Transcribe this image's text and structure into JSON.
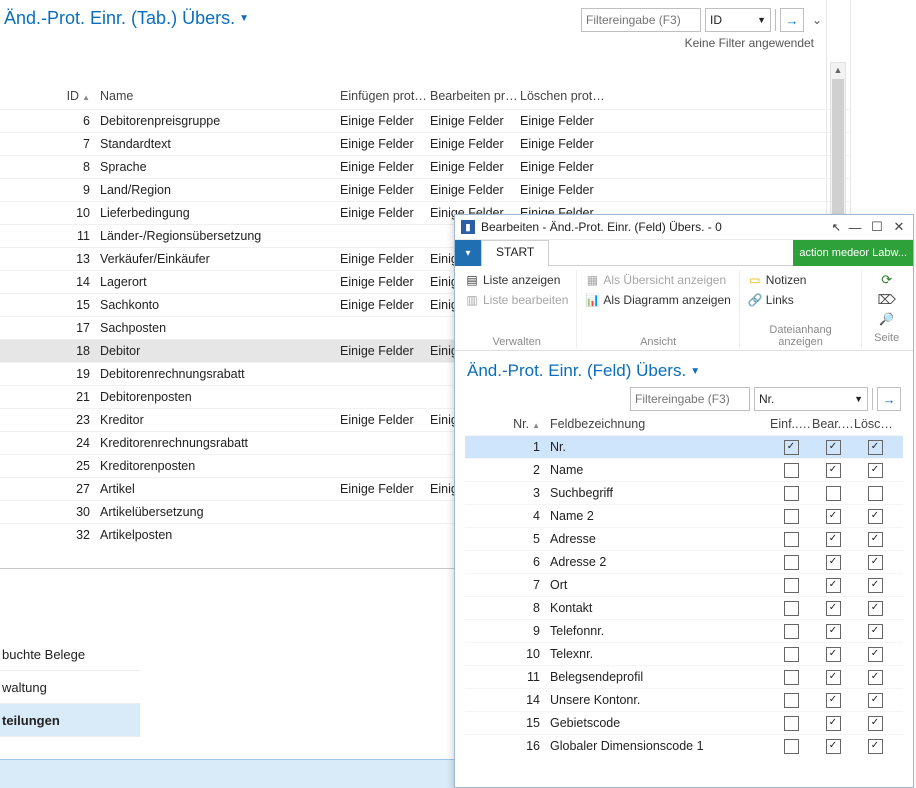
{
  "main": {
    "title": "Änd.-Prot. Einr. (Tab.) Übers.",
    "filter": {
      "placeholder": "Filtereingabe (F3)",
      "field": "ID",
      "go": "→"
    },
    "no_filter": "Keine Filter angewendet",
    "columns": {
      "id": "ID",
      "name": "Name",
      "ins": "Einfügen protokollier...",
      "upd": "Bearbeiten protokollier...",
      "del": "Löschen protokollier..."
    },
    "cell_default": "Einige Felder",
    "cell_trunc": "Einige...",
    "rows": [
      {
        "id": 6,
        "name": "Debitorenpreisgruppe",
        "ins": true,
        "upd": true,
        "del": true
      },
      {
        "id": 7,
        "name": "Standardtext",
        "ins": true,
        "upd": true,
        "del": true
      },
      {
        "id": 8,
        "name": "Sprache",
        "ins": true,
        "upd": true,
        "del": true
      },
      {
        "id": 9,
        "name": "Land/Region",
        "ins": true,
        "upd": true,
        "del": true
      },
      {
        "id": 10,
        "name": "Lieferbedingung",
        "ins": true,
        "upd": true,
        "del": true
      },
      {
        "id": 11,
        "name": "Länder-/Regionsübersetzung",
        "ins": false,
        "upd": false,
        "del": false
      },
      {
        "id": 13,
        "name": "Verkäufer/Einkäufer",
        "ins": true,
        "upd": true,
        "del": true
      },
      {
        "id": 14,
        "name": "Lagerort",
        "ins": true,
        "upd": true,
        "del": true
      },
      {
        "id": 15,
        "name": "Sachkonto",
        "ins": true,
        "upd": true,
        "del": true
      },
      {
        "id": 17,
        "name": "Sachposten",
        "ins": false,
        "upd": false,
        "del": false
      },
      {
        "id": 18,
        "name": "Debitor",
        "ins": true,
        "upd": "trunc",
        "del": false,
        "selected": true
      },
      {
        "id": 19,
        "name": "Debitorenrechnungsrabatt",
        "ins": false,
        "upd": false,
        "del": false
      },
      {
        "id": 21,
        "name": "Debitorenposten",
        "ins": false,
        "upd": false,
        "del": false
      },
      {
        "id": 23,
        "name": "Kreditor",
        "ins": true,
        "upd": "trunc",
        "del": false
      },
      {
        "id": 24,
        "name": "Kreditorenrechnungsrabatt",
        "ins": false,
        "upd": false,
        "del": false
      },
      {
        "id": 25,
        "name": "Kreditorenposten",
        "ins": false,
        "upd": false,
        "del": false
      },
      {
        "id": 27,
        "name": "Artikel",
        "ins": true,
        "upd": "trunc",
        "del": false
      },
      {
        "id": 30,
        "name": "Artikelübersetzung",
        "ins": false,
        "upd": false,
        "del": false
      },
      {
        "id": 32,
        "name": "Artikelposten",
        "ins": false,
        "upd": false,
        "del": false
      }
    ]
  },
  "sidebar": {
    "items": [
      {
        "label": "buchte Belege",
        "selected": false
      },
      {
        "label": "waltung",
        "selected": false
      },
      {
        "label": "teilungen",
        "selected": true
      }
    ]
  },
  "overlay": {
    "window_title": "Bearbeiten - Änd.-Prot. Einr. (Feld) Übers. - 0",
    "ribbon": {
      "file_glyph": "▾",
      "tab": "START",
      "badge": "action medeor Labw...",
      "groups": {
        "verwalten": {
          "label": "Verwalten",
          "list_show": "Liste anzeigen",
          "list_edit": "Liste bearbeiten"
        },
        "ansicht": {
          "label": "Ansicht",
          "as_overview": "Als Übersicht anzeigen",
          "as_chart": "Als Diagramm anzeigen"
        },
        "attach": {
          "label": "Dateianhang anzeigen",
          "notes": "Notizen",
          "links": "Links"
        },
        "page": {
          "label": "Seite"
        }
      }
    },
    "subtitle": "Änd.-Prot. Einr. (Feld) Übers.",
    "filter": {
      "placeholder": "Filtereingabe (F3)",
      "field": "Nr.",
      "go": "→"
    },
    "columns": {
      "nr": "Nr.",
      "caption": "Feldbezeichnung",
      "ins": "Einf... prot...",
      "upd": "Bear... prot...",
      "del": "Lösc... prot..."
    },
    "rows": [
      {
        "nr": 1,
        "caption": "Nr.",
        "ins": true,
        "upd": true,
        "del": true,
        "selected": true
      },
      {
        "nr": 2,
        "caption": "Name",
        "ins": false,
        "upd": true,
        "del": true
      },
      {
        "nr": 3,
        "caption": "Suchbegriff",
        "ins": false,
        "upd": false,
        "del": false
      },
      {
        "nr": 4,
        "caption": "Name 2",
        "ins": false,
        "upd": true,
        "del": true
      },
      {
        "nr": 5,
        "caption": "Adresse",
        "ins": false,
        "upd": true,
        "del": true
      },
      {
        "nr": 6,
        "caption": "Adresse 2",
        "ins": false,
        "upd": true,
        "del": true
      },
      {
        "nr": 7,
        "caption": "Ort",
        "ins": false,
        "upd": true,
        "del": true
      },
      {
        "nr": 8,
        "caption": "Kontakt",
        "ins": false,
        "upd": true,
        "del": true
      },
      {
        "nr": 9,
        "caption": "Telefonnr.",
        "ins": false,
        "upd": true,
        "del": true
      },
      {
        "nr": 10,
        "caption": "Telexnr.",
        "ins": false,
        "upd": true,
        "del": true
      },
      {
        "nr": 11,
        "caption": "Belegsendeprofil",
        "ins": false,
        "upd": true,
        "del": true
      },
      {
        "nr": 14,
        "caption": "Unsere Kontonr.",
        "ins": false,
        "upd": true,
        "del": true
      },
      {
        "nr": 15,
        "caption": "Gebietscode",
        "ins": false,
        "upd": true,
        "del": true
      },
      {
        "nr": 16,
        "caption": "Globaler Dimensionscode 1",
        "ins": false,
        "upd": true,
        "del": true
      }
    ]
  }
}
